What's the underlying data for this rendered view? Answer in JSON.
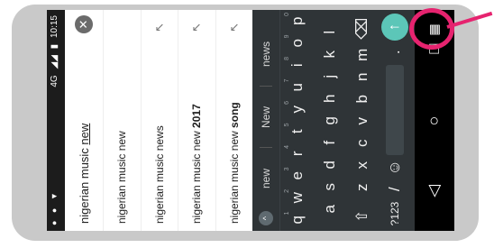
{
  "status_bar": {
    "left_icons": "● ● ▼",
    "network": "4G",
    "time": "10:15"
  },
  "search": {
    "prefix": "nigerian music ",
    "current_word": "new",
    "clear_icon": "close-icon"
  },
  "suggestions": [
    {
      "normal": "nigerian music new",
      "bold": ""
    },
    {
      "normal": "nigerian music news",
      "bold": ""
    },
    {
      "normal": "nigerian music new ",
      "bold": "2017"
    },
    {
      "normal": "nigerian music new ",
      "bold": "song"
    }
  ],
  "suggest_fill_icon": "↖",
  "keyboard": {
    "suggestions": [
      "new",
      "New",
      "news"
    ],
    "expand_icon": "^",
    "row1": [
      {
        "k": "q",
        "n": "1"
      },
      {
        "k": "w",
        "n": "2"
      },
      {
        "k": "e",
        "n": "3"
      },
      {
        "k": "r",
        "n": "4"
      },
      {
        "k": "t",
        "n": "5"
      },
      {
        "k": "y",
        "n": "6"
      },
      {
        "k": "u",
        "n": "7"
      },
      {
        "k": "i",
        "n": "8"
      },
      {
        "k": "o",
        "n": "9"
      },
      {
        "k": "p",
        "n": "0"
      }
    ],
    "row2": [
      "a",
      "s",
      "d",
      "f",
      "g",
      "h",
      "j",
      "k",
      "l"
    ],
    "row3": [
      "⇧",
      "z",
      "x",
      "c",
      "v",
      "b",
      "n",
      "m",
      "⌫"
    ],
    "row4_left": "?123",
    "row4_slash": "/",
    "row4_emoji": "☺",
    "row4_period": ".",
    "enter": "↑"
  },
  "nav": {
    "back": "◁",
    "home": "○",
    "recents": "□",
    "keyboard_switch": "▦"
  },
  "colors": {
    "highlight": "#e6236f",
    "enter_key": "#5cc6b8",
    "keyboard_bg": "#2f3437"
  }
}
